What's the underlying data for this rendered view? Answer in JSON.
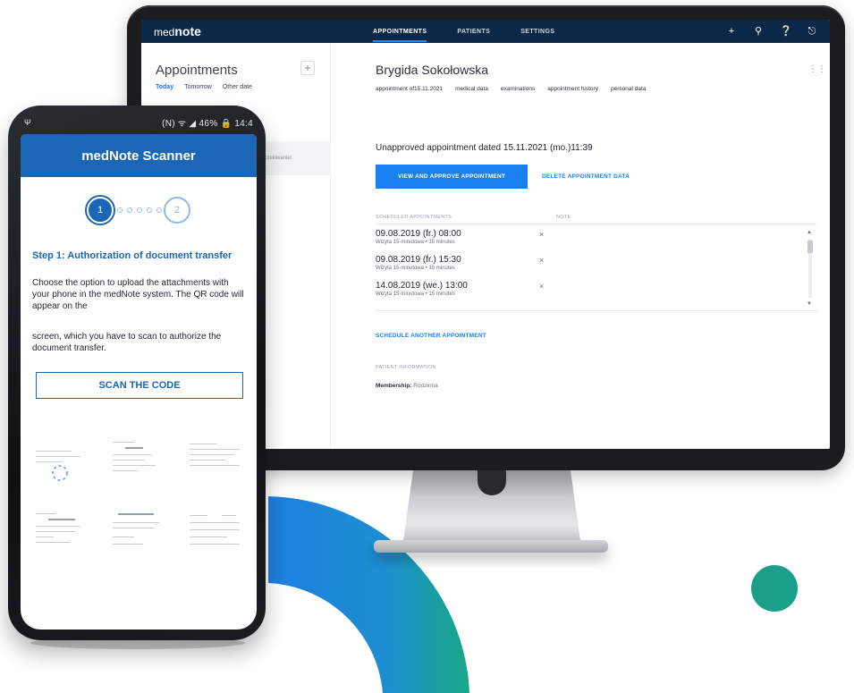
{
  "colors": {
    "navbar": "#0d2746",
    "accent": "#1a7ff0",
    "phone_header": "#1b66b5",
    "teal": "#1aa08a",
    "ring_blue": "#1d7fe0"
  },
  "desktop": {
    "logo": {
      "prefix": "med",
      "suffix": "note"
    },
    "nav": [
      "APPOINTMENTS",
      "PATIENTS",
      "SETTINGS"
    ],
    "active_nav": "APPOINTMENTS",
    "bar_icons": [
      "plus-icon",
      "notifications-icon",
      "help-icon",
      "logout-icon"
    ],
    "sidebar": {
      "title": "Appointments",
      "add_symbol": "+",
      "tabs": [
        "Today",
        "Tomorrow",
        "Other date"
      ],
      "selected_tab": "Today",
      "list_item_fragment": "oczekiwanie/"
    },
    "patient": {
      "name": "Brygida Sokołowska",
      "sub_tabs": [
        "appointment of15.11.2021",
        "medical data",
        "examinations",
        "appointment history",
        "personal data"
      ],
      "unapproved_text": "Unapproved appointment dated 15.11.2021 (mo.)11:39",
      "approve_button": "VIEW AND APPROVE APPOINTMENT",
      "delete_link": "DELETE APPOINTMENT DATA",
      "scheduled_header": "SCHEDULED APPOINTMENTS",
      "note_header": "NOTE",
      "scheduled": [
        {
          "when": "09.08.2019 (fr.) 08:00",
          "what": "Wizyta 15-minutowa • 15 minutes"
        },
        {
          "when": "09.08.2019 (fr.) 15:30",
          "what": "Wizyta 15-minutowa • 15 minutes"
        },
        {
          "when": "14.08.2019 (we.) 13:00",
          "what": "Wizyta 15-minutowa • 15 minutes"
        }
      ],
      "remove_symbol": "×",
      "schedule_link": "SCHEDULE ANOTHER APPOINTMENT",
      "patient_info_header": "PATIENT INFORMATION",
      "membership_label": "Membership:",
      "membership_value": "Rodzinna"
    }
  },
  "phone": {
    "status_left": "Ψ",
    "status_right": "(N) ᯤ ◢ 46% 🔒 14:4",
    "app_title": "medNote Scanner",
    "steps": [
      "1",
      "2"
    ],
    "current_step": 1,
    "step_title": "Step 1: Authorization of document transfer",
    "text_1": "Choose the option to upload the attachments with your phone in the medNote system. The QR code will appear on the",
    "text_2": "screen, which you have to scan to authorize the document transfer.",
    "scan_button": "SCAN THE CODE"
  }
}
